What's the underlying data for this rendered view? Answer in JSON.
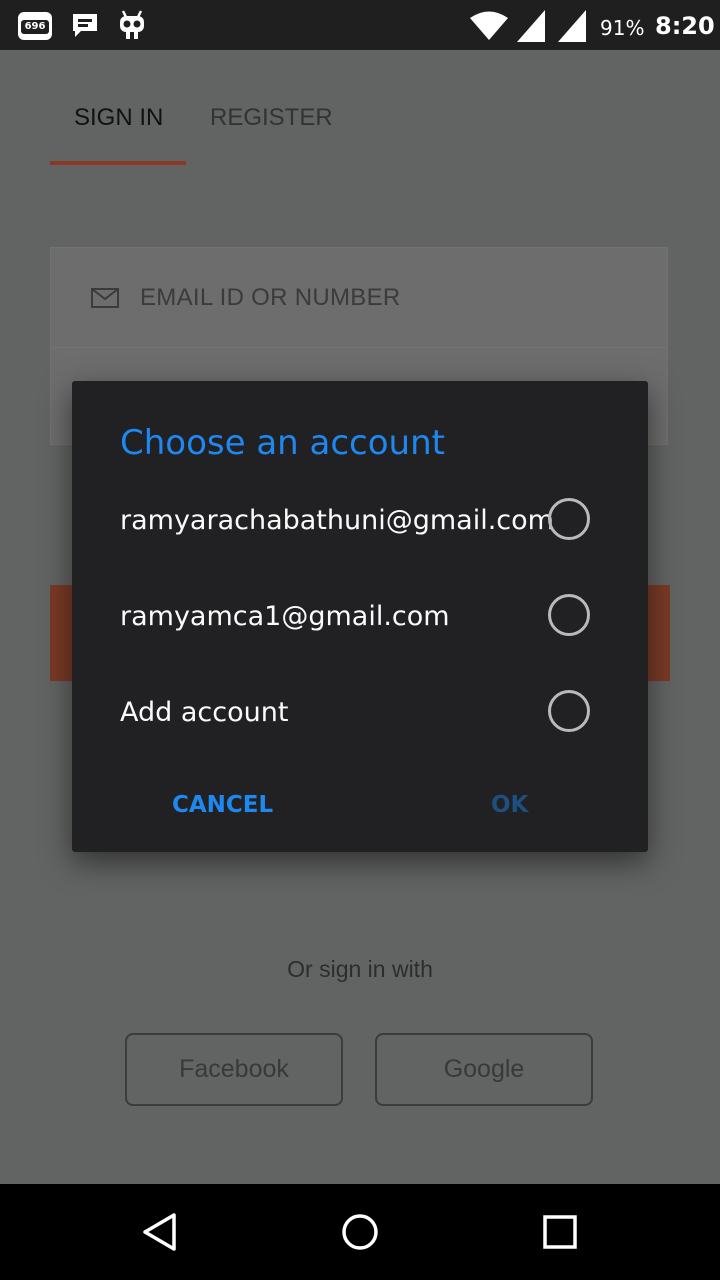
{
  "status_bar": {
    "badge_count": "696",
    "battery_percent": "91%",
    "time": "8:20"
  },
  "tabs": {
    "signin": "SIGN IN",
    "register": "REGISTER"
  },
  "form": {
    "email_placeholder": "EMAIL ID OR NUMBER"
  },
  "social": {
    "or_text": "Or sign in with",
    "facebook": "Facebook",
    "google": "Google"
  },
  "dialog": {
    "title": "Choose an account",
    "options": [
      {
        "label": "ramyarachabathuni@gmail.com"
      },
      {
        "label": "ramyamca1@gmail.com"
      },
      {
        "label": "Add account"
      }
    ],
    "cancel": "CANCEL",
    "ok": "OK"
  },
  "colors": {
    "accent": "#1e88f0",
    "dialog_bg": "#212123",
    "brand": "#7a3a25"
  }
}
